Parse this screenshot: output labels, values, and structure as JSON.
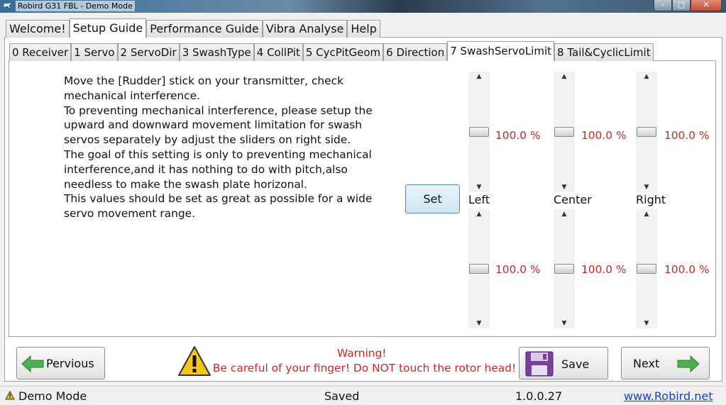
{
  "window": {
    "title": "Robird G31 FBL - Demo Mode",
    "buttons": {
      "minimize": "–",
      "maximize": "□",
      "close": "✕"
    }
  },
  "main_tabs": [
    "Welcome!",
    "Setup Guide",
    "Performance Guide",
    "Vibra Analyse",
    "Help"
  ],
  "sub_tabs": [
    "0 Receiver",
    "1 Servo",
    "2 ServoDir",
    "3 SwashType",
    "4 CollPit",
    "5 CycPitGeom",
    "6 Direction",
    "7 SwashServoLimit",
    "8 Tail&CyclicLimit"
  ],
  "instructions": [
    "Move the [Rudder] stick on your transmitter, check\nmechanical interference.",
    "To preventing mechanical interference, please setup the\nupward and downward movement limitation for swash\nservos separately by adjust the sliders on right side.",
    "The goal of this setting is only to preventing mechanical\ninterference,and it has nothing to do with pitch,also\nneedless to make the swash plate horizonal.",
    "This values should be set as great as possible for a wide\nservo movement range."
  ],
  "set_button": "Set",
  "sliders": {
    "left": {
      "label": "Left",
      "upper": "100.0 %",
      "lower": "100.0 %",
      "upper_level": 0.5,
      "lower_level": 0.5
    },
    "center": {
      "label": "Center",
      "upper": "100.0 %",
      "lower": "100.0 %",
      "upper_level": 0.5,
      "lower_level": 0.5
    },
    "right": {
      "label": "Right",
      "upper": "100.0 %",
      "lower": "100.0 %",
      "upper_level": 0.5,
      "lower_level": 0.5
    }
  },
  "nav": {
    "previous": "Pervious",
    "save": "Save",
    "next": "Next"
  },
  "warning": {
    "title": "Warning!",
    "text": "Be careful of your finger! Do NOT touch the rotor head!"
  },
  "status": {
    "mode": "Demo Mode",
    "state": "Saved",
    "version": "1.0.0.27",
    "website": "www.Robird.net"
  },
  "colors": {
    "warning_red": "#c62828",
    "arrow_green": "#4caf50",
    "save_purple": "#7b3f9e",
    "link_blue": "#1a3fd0"
  },
  "icons": {
    "app": "robird-icon",
    "warning": "warning-triangle-icon",
    "prev": "arrow-left-icon",
    "next": "arrow-right-icon",
    "save": "floppy-disk-icon",
    "status": "warning-small-icon"
  }
}
